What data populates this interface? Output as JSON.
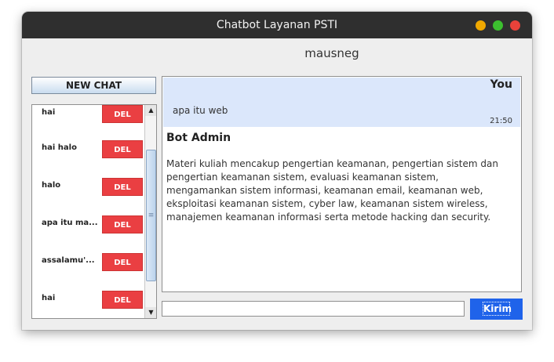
{
  "window": {
    "title": "Chatbot Layanan PSTI"
  },
  "header": {
    "username": "mausneg"
  },
  "sidebar": {
    "new_chat_label": "NEW CHAT",
    "items": [
      {
        "label": "hai",
        "delete_label": "DEL"
      },
      {
        "label": "hai halo",
        "delete_label": "DEL"
      },
      {
        "label": "halo",
        "delete_label": "DEL"
      },
      {
        "label": "apa itu ma...",
        "delete_label": "DEL"
      },
      {
        "label": "assalamu'...",
        "delete_label": "DEL"
      },
      {
        "label": "hai",
        "delete_label": "DEL"
      }
    ]
  },
  "chat": {
    "user_message": {
      "sender": "You",
      "text": "apa itu web",
      "time": "21:50"
    },
    "bot_message": {
      "sender": "Bot Admin",
      "text": "Materi kuliah mencakup pengertian keamanan, pengertian sistem dan pengertian keamanan sistem, evaluasi keamanan sistem, mengamankan sistem informasi, keamanan email, keamanan web, eksploitasi keamanan sistem, cyber law, keamanan sistem wireless, manajemen keamanan informasi serta metode hacking dan security."
    }
  },
  "input": {
    "value": "",
    "send_label": "Kirim"
  },
  "colors": {
    "titlebar": "#2f2f2f",
    "delete_button": "#ea3f42",
    "send_button": "#1f63ea",
    "user_bubble": "#dbe7fb"
  }
}
